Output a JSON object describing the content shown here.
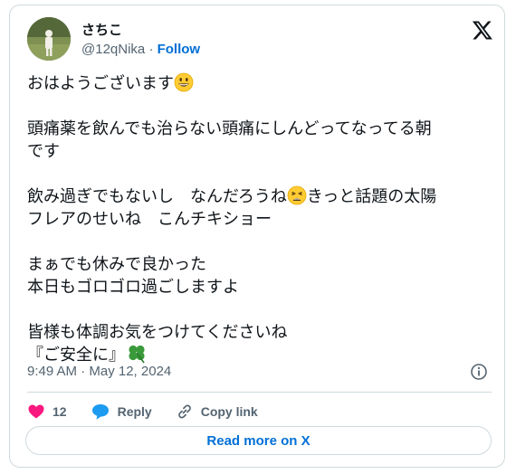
{
  "author": {
    "display_name": "さちこ",
    "handle": "@12qNika",
    "separator": "·",
    "follow_label": "Follow"
  },
  "tweet": {
    "line1": "おはようございます",
    "line2": "頭痛薬を飲んでも治らない頭痛にしんどってなってる朝",
    "line3": "です",
    "line4a": "飲み過ぎでもないし　なんだろうね",
    "line4b": "きっと話題の太陽",
    "line5": "フレアのせいね　こんチキショー",
    "line6": "まぁでも休みで良かった",
    "line7": "本日もゴロゴロ過ごしますよ",
    "line8": "皆様も体調お気をつけてくださいね",
    "line9": "『ご安全に』",
    "emoji_smile": "grinning-face",
    "emoji_weary": "weary-face",
    "emoji_clover": "four-leaf-clover"
  },
  "timestamp": "9:49 AM · May 12, 2024",
  "actions": {
    "like_count": "12",
    "reply_label": "Reply",
    "copy_label": "Copy link"
  },
  "read_more_label": "Read more on X",
  "colors": {
    "accent": "#006fd6",
    "like": "#f91880",
    "muted": "#536471",
    "border": "#cfd9de"
  }
}
